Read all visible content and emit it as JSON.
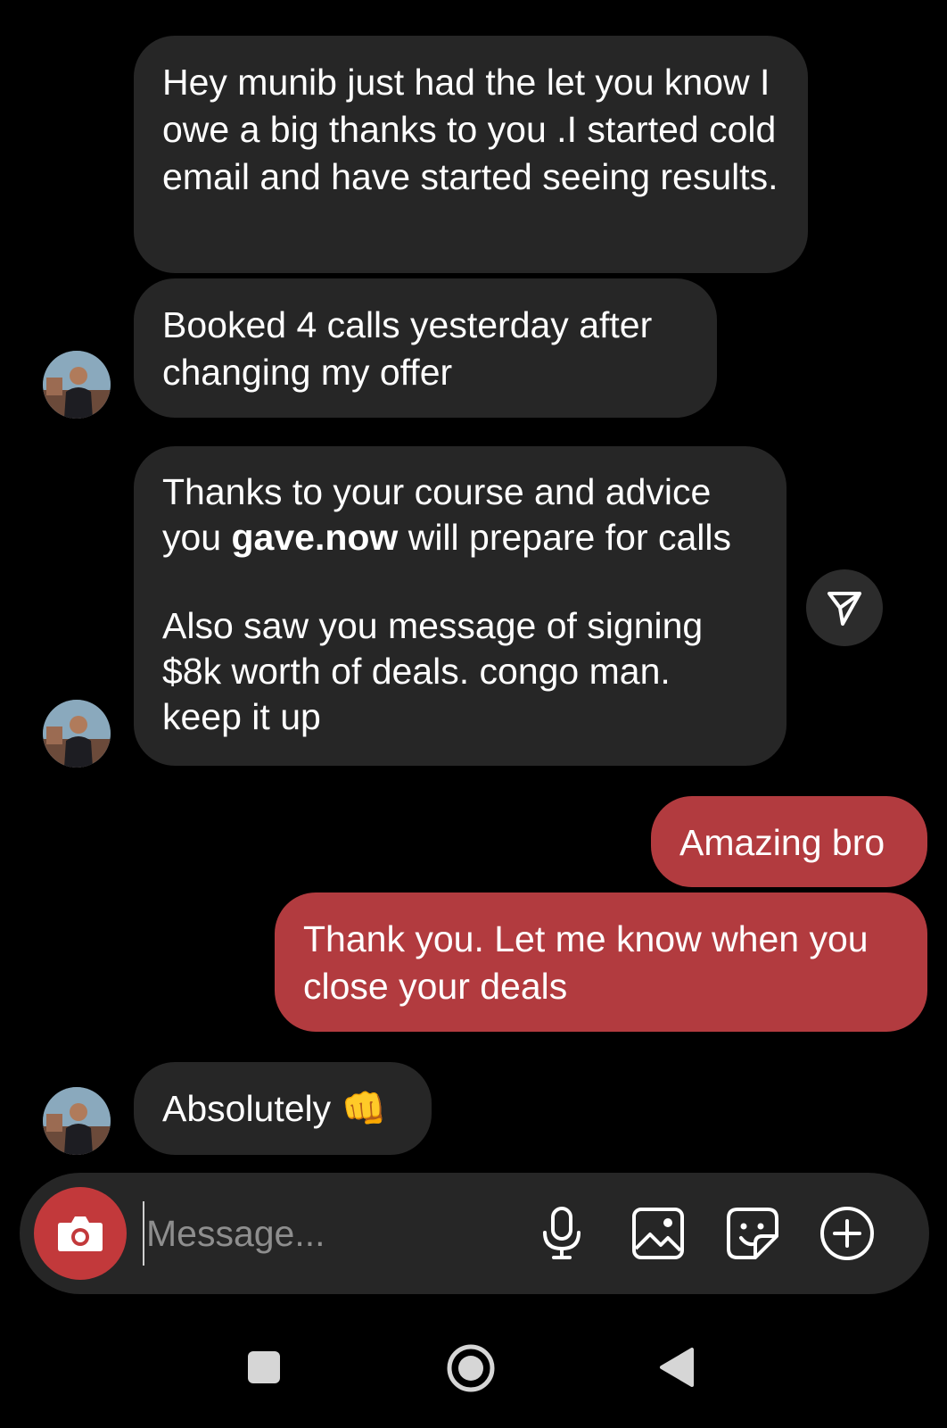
{
  "messages": [
    {
      "id": "m1",
      "direction": "incoming",
      "text": "Hey munib just had the let you know I owe a big thanks to you .I started cold email and have started seeing results."
    },
    {
      "id": "m2",
      "direction": "incoming",
      "text": "Booked 4 calls yesterday after changing my offer"
    },
    {
      "id": "m3",
      "direction": "incoming",
      "line1": "Thanks to your course and advice",
      "line2_pre": "you ",
      "line2_bold": "gave.now",
      "line2_post": " will prepare for calls",
      "line3": "Also saw you message of signing $8k worth of deals. congo man. keep it up"
    },
    {
      "id": "m4",
      "direction": "outgoing",
      "text": "Amazing bro"
    },
    {
      "id": "m5",
      "direction": "outgoing",
      "text": "Thank you. Let me know when you close your deals"
    },
    {
      "id": "m6",
      "direction": "incoming",
      "text": "Absolutely",
      "emoji": "👊"
    }
  ],
  "composer": {
    "placeholder": "Message...",
    "icons": [
      "camera-icon",
      "microphone-icon",
      "gallery-icon",
      "sticker-icon",
      "add-icon"
    ]
  },
  "nav_bar": {
    "icons": [
      "recents-square-icon",
      "home-circle-icon",
      "back-triangle-icon"
    ]
  },
  "colors": {
    "background": "#000000",
    "incoming_bubble": "#262626",
    "outgoing_bubble": "#b23b3f",
    "camera_button": "#c2393b",
    "text": "#ffffff",
    "placeholder": "#8e8e8e"
  }
}
